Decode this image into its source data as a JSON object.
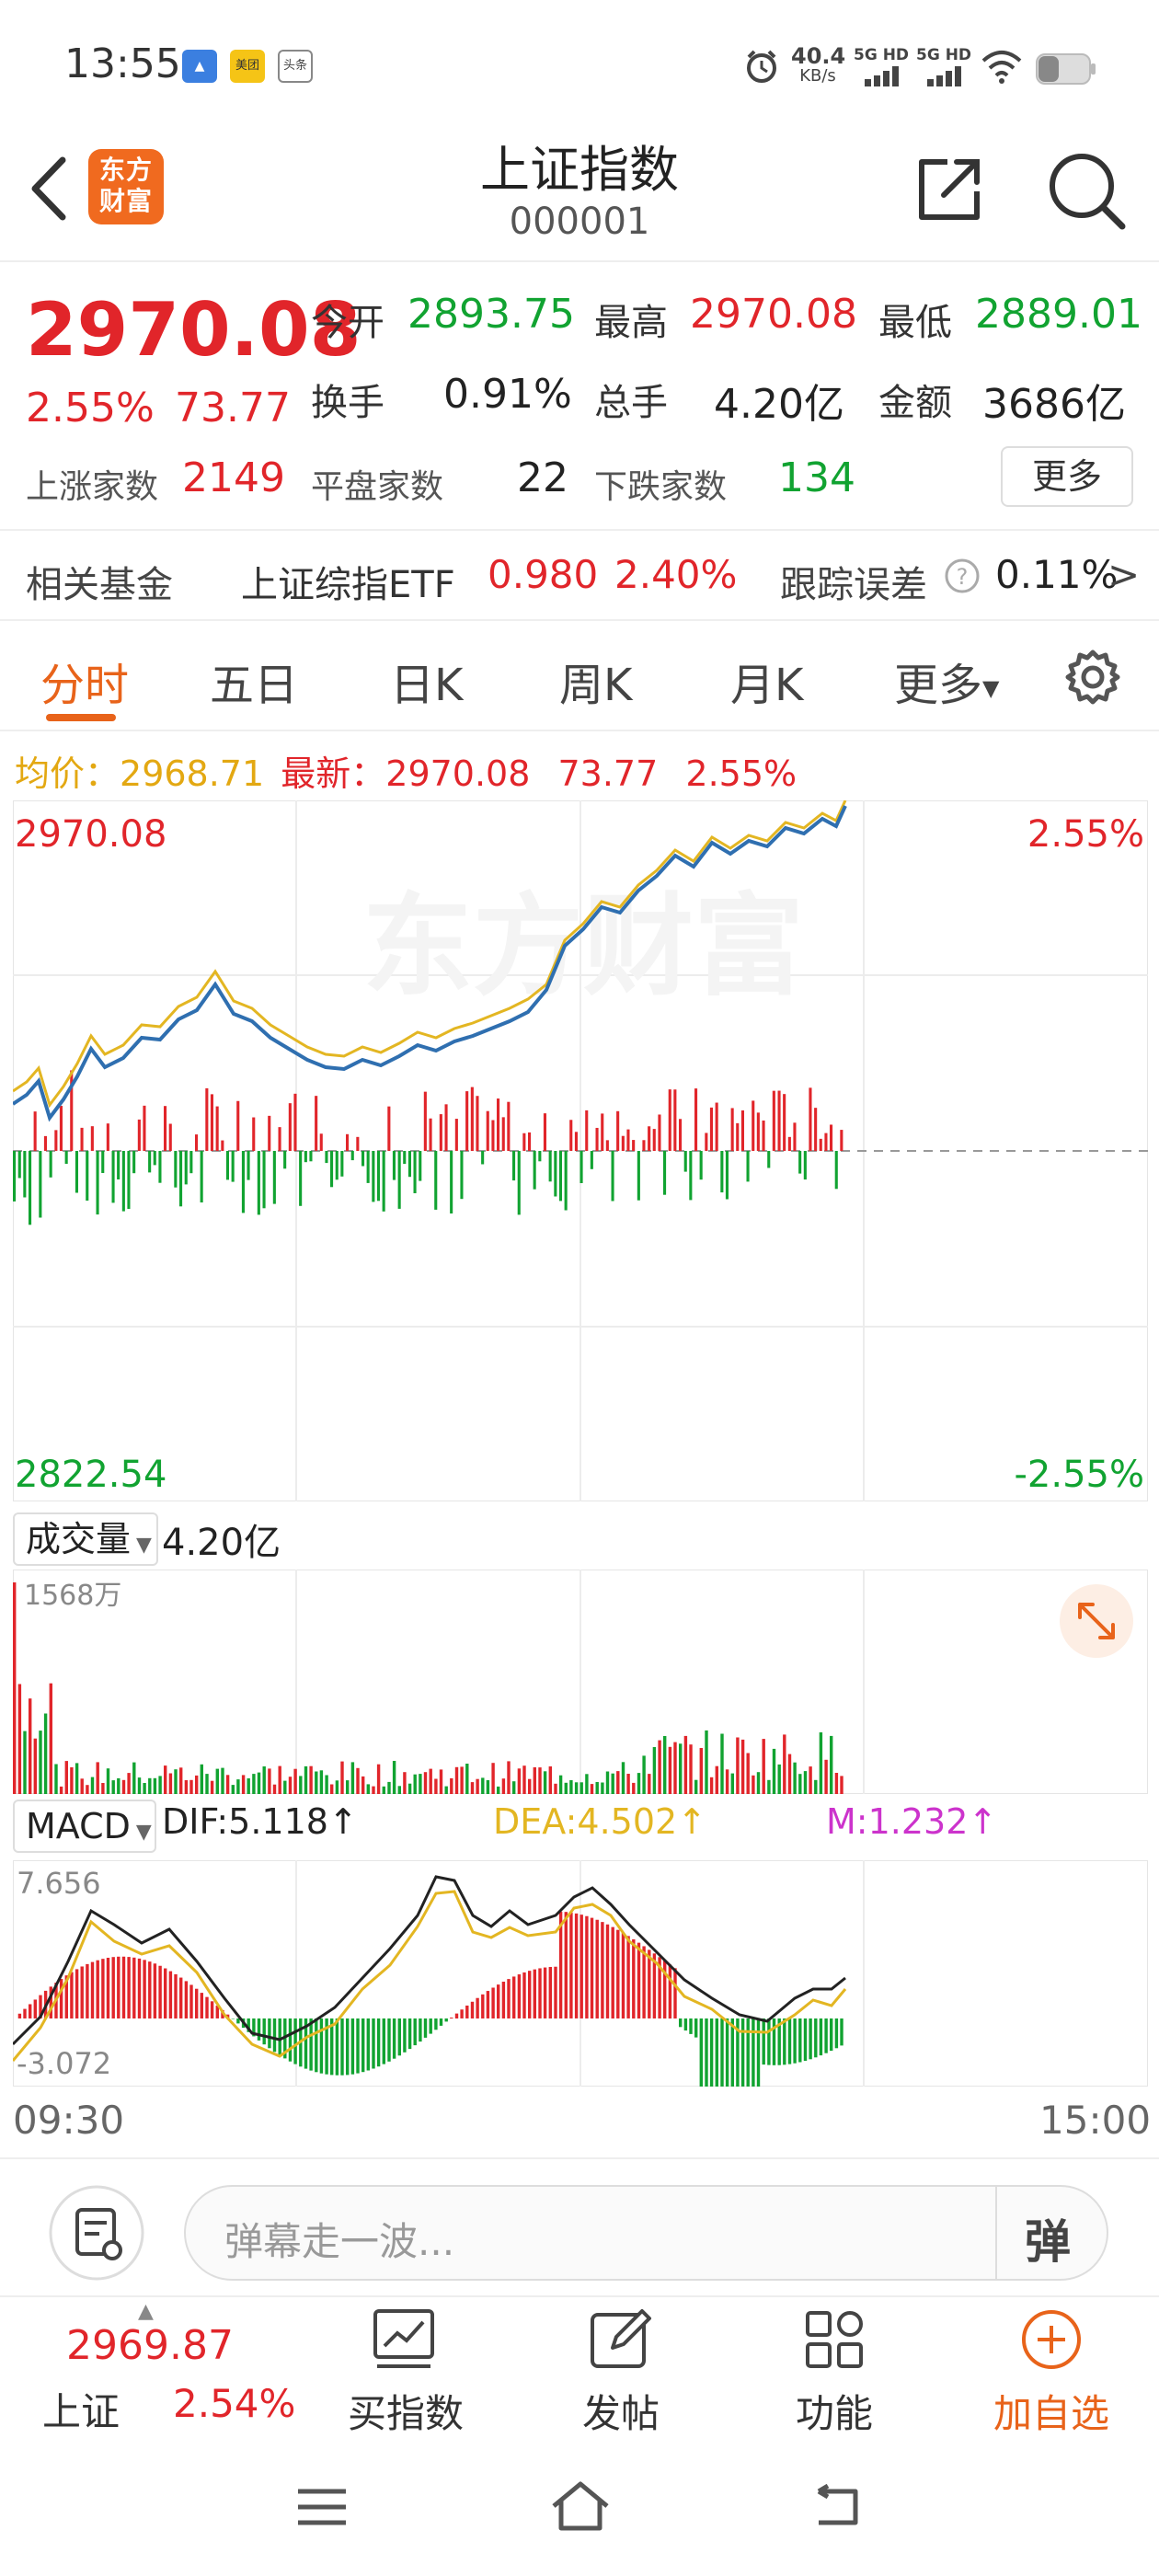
{
  "status_bar": {
    "time": "13:55",
    "app_icons": [
      "美团",
      "头条"
    ],
    "net_speed_value": "40.4",
    "net_speed_unit": "KB/s",
    "signal_1": "5G HD",
    "signal_2": "5G HD"
  },
  "header": {
    "logo_text": "东方财富",
    "title": "上证指数",
    "code": "000001"
  },
  "quote": {
    "price": "2970.08",
    "change_pct": "2.55%",
    "change": "73.77",
    "open_label": "今开",
    "open": "2893.75",
    "high_label": "最高",
    "high": "2970.08",
    "low_label": "最低",
    "low": "2889.01",
    "turnover_label": "换手",
    "turnover": "0.91%",
    "volume_label": "总手",
    "volume": "4.20亿",
    "amount_label": "金额",
    "amount": "3686亿",
    "up_label": "上涨家数",
    "up_count": "2149",
    "flat_label": "平盘家数",
    "flat_count": "22",
    "down_label": "下跌家数",
    "down_count": "134",
    "more_button": "更多"
  },
  "fund": {
    "label": "相关基金",
    "name": "上证综指ETF",
    "price": "0.980",
    "pct": "2.40%",
    "tracking_label": "跟踪误差",
    "tracking_value": "0.11%",
    "arrow": ">"
  },
  "tabs": [
    "分时",
    "五日",
    "日K",
    "周K",
    "月K",
    "更多"
  ],
  "intraday": {
    "avg_label": "均价：",
    "avg_value": "2968.71",
    "latest_label": "最新：",
    "latest_value": "2970.08",
    "latest_change": "73.77",
    "latest_pct": "2.55%",
    "top_price": "2970.08",
    "bottom_price": "2822.54",
    "top_pct": "2.55%",
    "bottom_pct": "-2.55%",
    "watermark": "东方财富"
  },
  "volume_panel": {
    "label": "成交量",
    "total": "4.20亿",
    "max_label": "1568万"
  },
  "macd_panel": {
    "label": "MACD",
    "dif": "DIF:5.118",
    "dea": "DEA:4.502",
    "m": "M:1.232",
    "arrow": "↑",
    "top": "7.656",
    "bottom": "-3.072"
  },
  "time_axis": {
    "start": "09:30",
    "end": "15:00"
  },
  "danmu": {
    "placeholder": "弹幕走一波...",
    "button": "弹"
  },
  "bottom_nav": {
    "index_price": "2969.87",
    "index_name": "上证",
    "index_pct": "2.54%",
    "buy_index": "买指数",
    "post": "发帖",
    "functions": "功能",
    "add_watch": "加自选"
  },
  "colors": {
    "up": "#e1252a",
    "down": "#11a331",
    "accent": "#e8631a",
    "price_line": "#2f6fb0",
    "avg_line": "#e3b622",
    "macd_dea": "#e3b622",
    "macd_m": "#cc33cc"
  }
}
